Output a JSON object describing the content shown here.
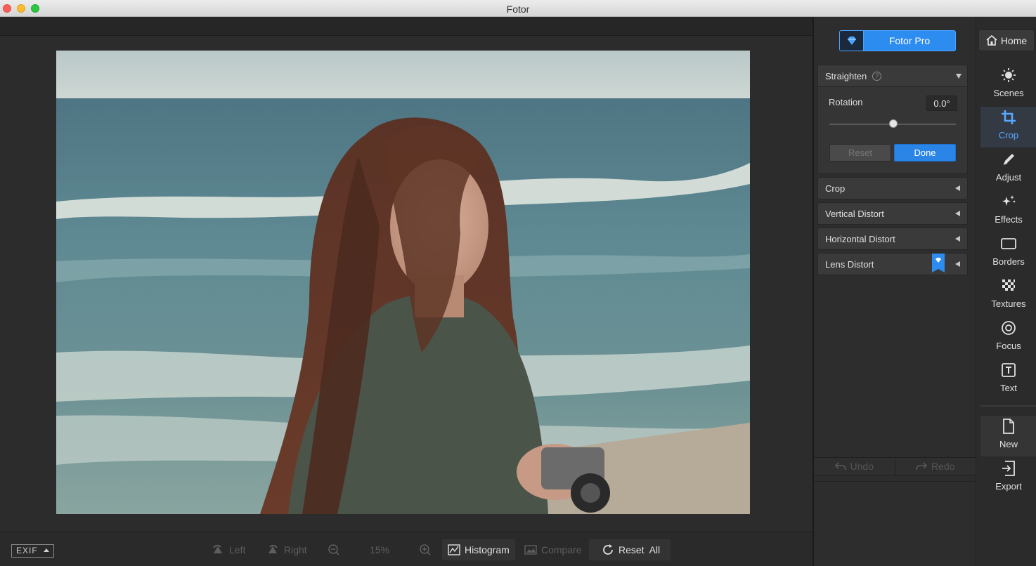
{
  "window": {
    "title": "Fotor"
  },
  "bottom_toolbar": {
    "exif_label": "EXIF",
    "rotate_left_label": "Left",
    "rotate_right_label": "Right",
    "zoom_value": "15%",
    "histogram_label": "Histogram",
    "compare_label": "Compare",
    "reset_all_label": "Reset  All"
  },
  "panel": {
    "pro_label": "Fotor Pro",
    "straighten": {
      "title": "Straighten",
      "rotation_label": "Rotation",
      "rotation_value": "0.0°",
      "reset_label": "Reset",
      "done_label": "Done"
    },
    "sections": [
      "Crop",
      "Vertical Distort",
      "Horizontal Distort",
      "Lens Distort"
    ],
    "undo_label": "Undo",
    "redo_label": "Redo"
  },
  "sidebar": {
    "home_label": "Home",
    "tools": [
      {
        "label": "Scenes",
        "icon": "sun-icon"
      },
      {
        "label": "Crop",
        "icon": "crop-icon"
      },
      {
        "label": "Adjust",
        "icon": "pencil-icon"
      },
      {
        "label": "Effects",
        "icon": "sparkle-icon"
      },
      {
        "label": "Borders",
        "icon": "frame-icon"
      },
      {
        "label": "Textures",
        "icon": "checker-icon"
      },
      {
        "label": "Focus",
        "icon": "target-icon"
      },
      {
        "label": "Text",
        "icon": "text-icon"
      },
      {
        "label": "New",
        "icon": "new-file-icon"
      },
      {
        "label": "Export",
        "icon": "export-icon"
      }
    ],
    "active_tool": "Crop"
  },
  "colors": {
    "accent": "#2d8cf0",
    "active_tool_text": "#58a8ff"
  }
}
